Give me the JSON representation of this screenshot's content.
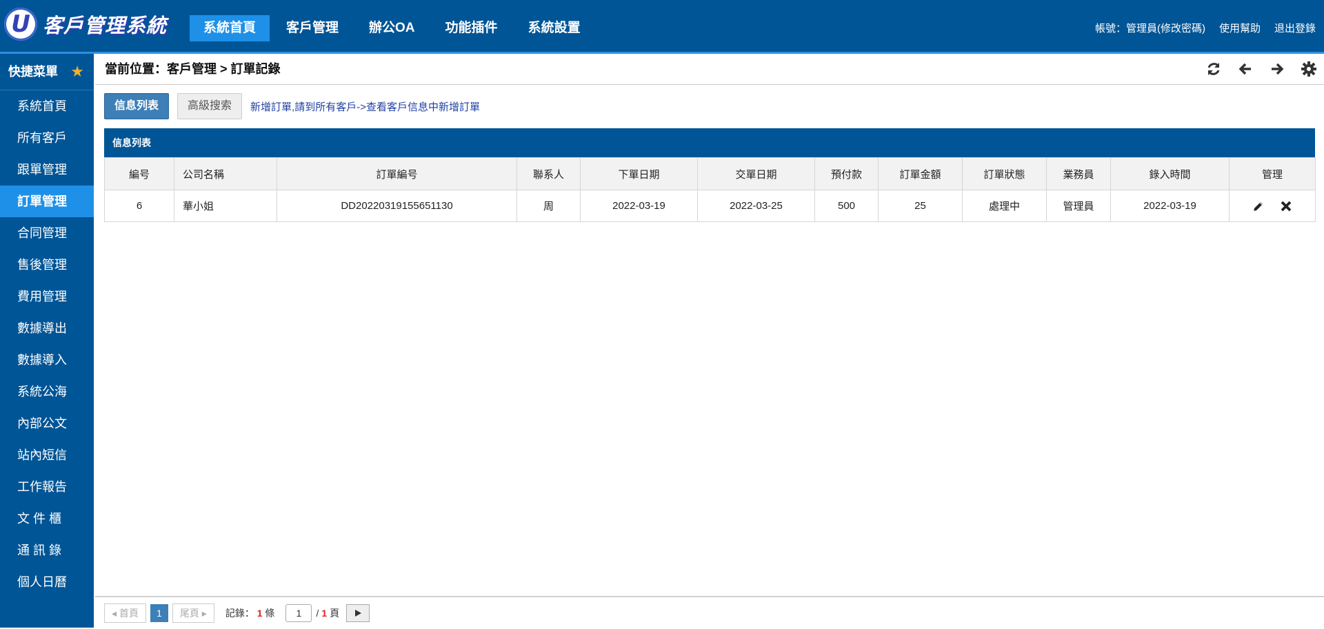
{
  "app": {
    "logo_letter": "U",
    "logo_text": "客戶管理系統"
  },
  "nav": [
    {
      "label": "系統首頁",
      "active": true
    },
    {
      "label": "客戶管理",
      "active": false
    },
    {
      "label": "辦公OA",
      "active": false
    },
    {
      "label": "功能插件",
      "active": false
    },
    {
      "label": "系統設置",
      "active": false
    }
  ],
  "top_right": {
    "account": "帳號：管理員(修改密碼)",
    "help": "使用幫助",
    "logout": "退出登錄"
  },
  "sidebar": {
    "header": "快捷菜單",
    "items": [
      {
        "label": "系統首頁"
      },
      {
        "label": "所有客戶"
      },
      {
        "label": "跟單管理"
      },
      {
        "label": "訂單管理"
      },
      {
        "label": "合同管理"
      },
      {
        "label": "售後管理"
      },
      {
        "label": "費用管理"
      },
      {
        "label": "數據導出"
      },
      {
        "label": "數據導入"
      },
      {
        "label": "系統公海"
      },
      {
        "label": "內部公文"
      },
      {
        "label": "站內短信"
      },
      {
        "label": "工作報告"
      },
      {
        "label": "文 件 櫃"
      },
      {
        "label": "通 訊 錄"
      },
      {
        "label": "個人日曆"
      }
    ],
    "active_index": 3
  },
  "breadcrumb": "當前位置：客戶管理 > 訂單記錄",
  "actions": {
    "list_label": "信息列表",
    "search_label": "高級搜索",
    "add_hint": "新增訂單,請到所有客戶->查看客戶信息中新增訂單"
  },
  "table": {
    "title": "信息列表",
    "columns": [
      "編号",
      "公司名稱",
      "訂單編号",
      "聯系人",
      "下單日期",
      "交單日期",
      "預付款",
      "訂單金額",
      "訂單狀態",
      "業務員",
      "錄入時間",
      "管理"
    ],
    "rows": [
      [
        "6",
        "華小姐",
        "DD20220319155651130",
        "周",
        "2022-03-19",
        "2022-03-25",
        "500",
        "25",
        "處理中",
        "管理員",
        "2022-03-19"
      ]
    ]
  },
  "pager": {
    "first_label": "◂ 首頁",
    "current_page": "1",
    "last_label": "尾頁 ▸",
    "records_prefix": "記錄：",
    "records_count": "1",
    "records_suffix": "條",
    "page_input": "1",
    "page_sep": "/",
    "total_pages": "1",
    "page_suffix": "頁"
  },
  "colors": {
    "brand": "#005596",
    "accent": "#1e90e8",
    "star": "#f5b02b"
  }
}
